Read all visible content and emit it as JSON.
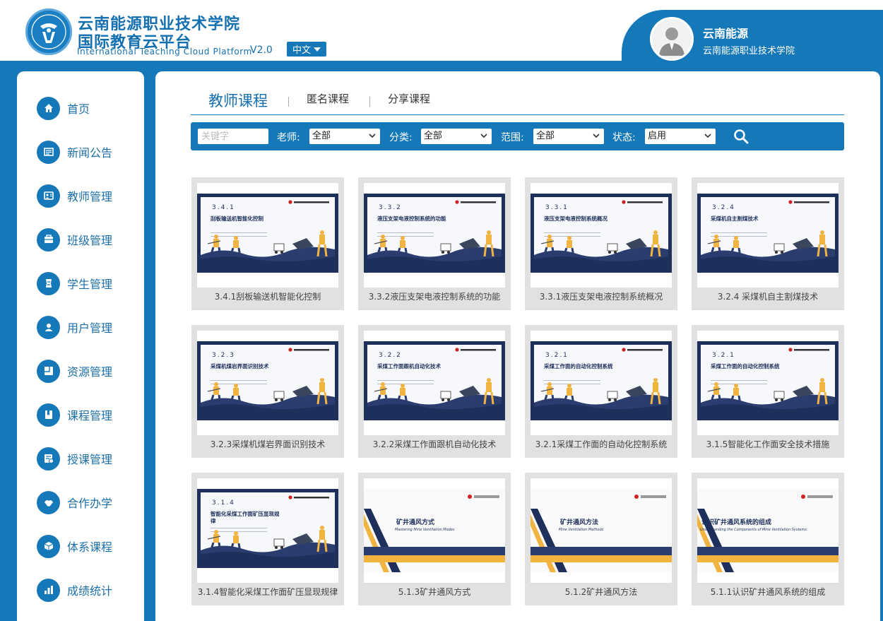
{
  "header": {
    "title_line1": "云南能源职业技术学院",
    "title_line2": "国际教育云平台",
    "title_en": "International Teaching Cloud Platform",
    "version": "V2.0",
    "language": "中文"
  },
  "user": {
    "name": "云南能源",
    "org": "云南能源职业技术学院"
  },
  "sidebar": {
    "items": [
      {
        "label": "首页",
        "icon": "home-icon"
      },
      {
        "label": "新闻公告",
        "icon": "news-icon"
      },
      {
        "label": "教师管理",
        "icon": "teacher-icon"
      },
      {
        "label": "班级管理",
        "icon": "class-icon"
      },
      {
        "label": "学生管理",
        "icon": "student-icon"
      },
      {
        "label": "用户管理",
        "icon": "user-icon"
      },
      {
        "label": "资源管理",
        "icon": "resource-icon"
      },
      {
        "label": "课程管理",
        "icon": "course-icon"
      },
      {
        "label": "授课管理",
        "icon": "teaching-icon"
      },
      {
        "label": "合作办学",
        "icon": "cooperation-icon"
      },
      {
        "label": "体系课程",
        "icon": "system-course-icon"
      },
      {
        "label": "成绩统计",
        "icon": "stats-icon"
      }
    ]
  },
  "tabs": [
    {
      "label": "教师课程",
      "active": true
    },
    {
      "label": "匿名课程",
      "active": false
    },
    {
      "label": "分享课程",
      "active": false
    }
  ],
  "filters": {
    "keyword_placeholder": "关键字",
    "teacher_label": "老师:",
    "teacher_value": "全部",
    "category_label": "分类:",
    "category_value": "全部",
    "scope_label": "范围:",
    "scope_value": "全部",
    "status_label": "状态:",
    "status_value": "启用"
  },
  "courses": [
    {
      "title": "3.4.1刮板输送机智能化控制",
      "slide_num": "3.4.1",
      "slide_title": "刮板输送机智能化控制",
      "style": "worker"
    },
    {
      "title": "3.3.2液压支架电液控制系统的功能",
      "slide_num": "3.3.2",
      "slide_title": "液压支架电液控制系统的功能",
      "style": "worker"
    },
    {
      "title": "3.3.1液压支架电液控制系统概况",
      "slide_num": "3.3.1",
      "slide_title": "液压支架电液控制系统概况",
      "style": "worker"
    },
    {
      "title": "3.2.4 采煤机自主割煤技术",
      "slide_num": "3.2.4",
      "slide_title": "采煤机自主割煤技术",
      "style": "worker"
    },
    {
      "title": "3.2.3采煤机煤岩界面识别技术",
      "slide_num": "3.2.3",
      "slide_title": "采煤机煤岩界面识别技术",
      "style": "worker"
    },
    {
      "title": "3.2.2采煤工作面跟机自动化技术",
      "slide_num": "3.2.2",
      "slide_title": "采煤工作面跟机自动化技术",
      "style": "worker"
    },
    {
      "title": "3.2.1采煤工作面的自动化控制系统",
      "slide_num": "3.2.1",
      "slide_title": "采煤工作面的自动化控制系统",
      "style": "worker"
    },
    {
      "title": "3.1.5智能化工作面安全技术措施",
      "slide_num": "3.2.1",
      "slide_title": "采煤工作面的自动化控制系统",
      "style": "worker"
    },
    {
      "title": "3.1.4智能化采煤工作面矿压显现规律",
      "slide_num": "3.1.4",
      "slide_title": "智能化采煤工作面矿压显现规律",
      "style": "worker"
    },
    {
      "title": "5.1.3矿井通风方式",
      "slide_title": "矿井通风方式",
      "slide_sub": "Mastering Mine Ventilation Modes",
      "style": "stripe"
    },
    {
      "title": "5.1.2矿井通风方法",
      "slide_title": "矿井通风方法",
      "slide_sub": "Mine Ventilation Methods",
      "style": "stripe"
    },
    {
      "title": "5.1.1认识矿井通风系统的组成",
      "slide_title": "认识矿井通风系统的组成",
      "slide_sub": "Understanding the Components of Mine Ventilation Systems",
      "style": "stripe"
    }
  ],
  "colors": {
    "primary": "#1578b8",
    "slide_navy": "#1e2f5c",
    "slide_gold": "#f2b441"
  }
}
